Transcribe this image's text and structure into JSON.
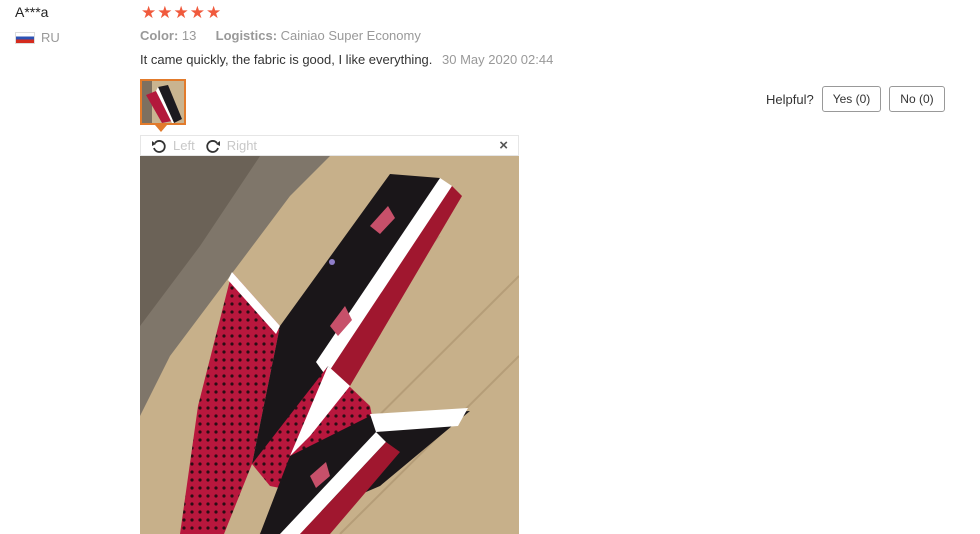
{
  "reviewer": {
    "name": "A***a",
    "country_code": "RU",
    "flag_icon": "russia-flag-icon"
  },
  "rating": {
    "stars": 5,
    "display": "★★★★★"
  },
  "meta": {
    "color_label": "Color:",
    "color_value": "13",
    "logistics_label": "Logistics:",
    "logistics_value": "Cainiao Super Economy"
  },
  "review": {
    "text": "It came quickly, the fabric is good, I like everything.",
    "date": "30 May 2020 02:44"
  },
  "helpful": {
    "label": "Helpful?",
    "yes_label": "Yes (0)",
    "no_label": "No (0)"
  },
  "viewer": {
    "rotate_left_label": "Left",
    "rotate_right_label": "Right",
    "close_symbol": "×"
  },
  "colors": {
    "star": "#f05a3d",
    "thumb_border": "#e27b2c",
    "muted_text": "#999999"
  }
}
